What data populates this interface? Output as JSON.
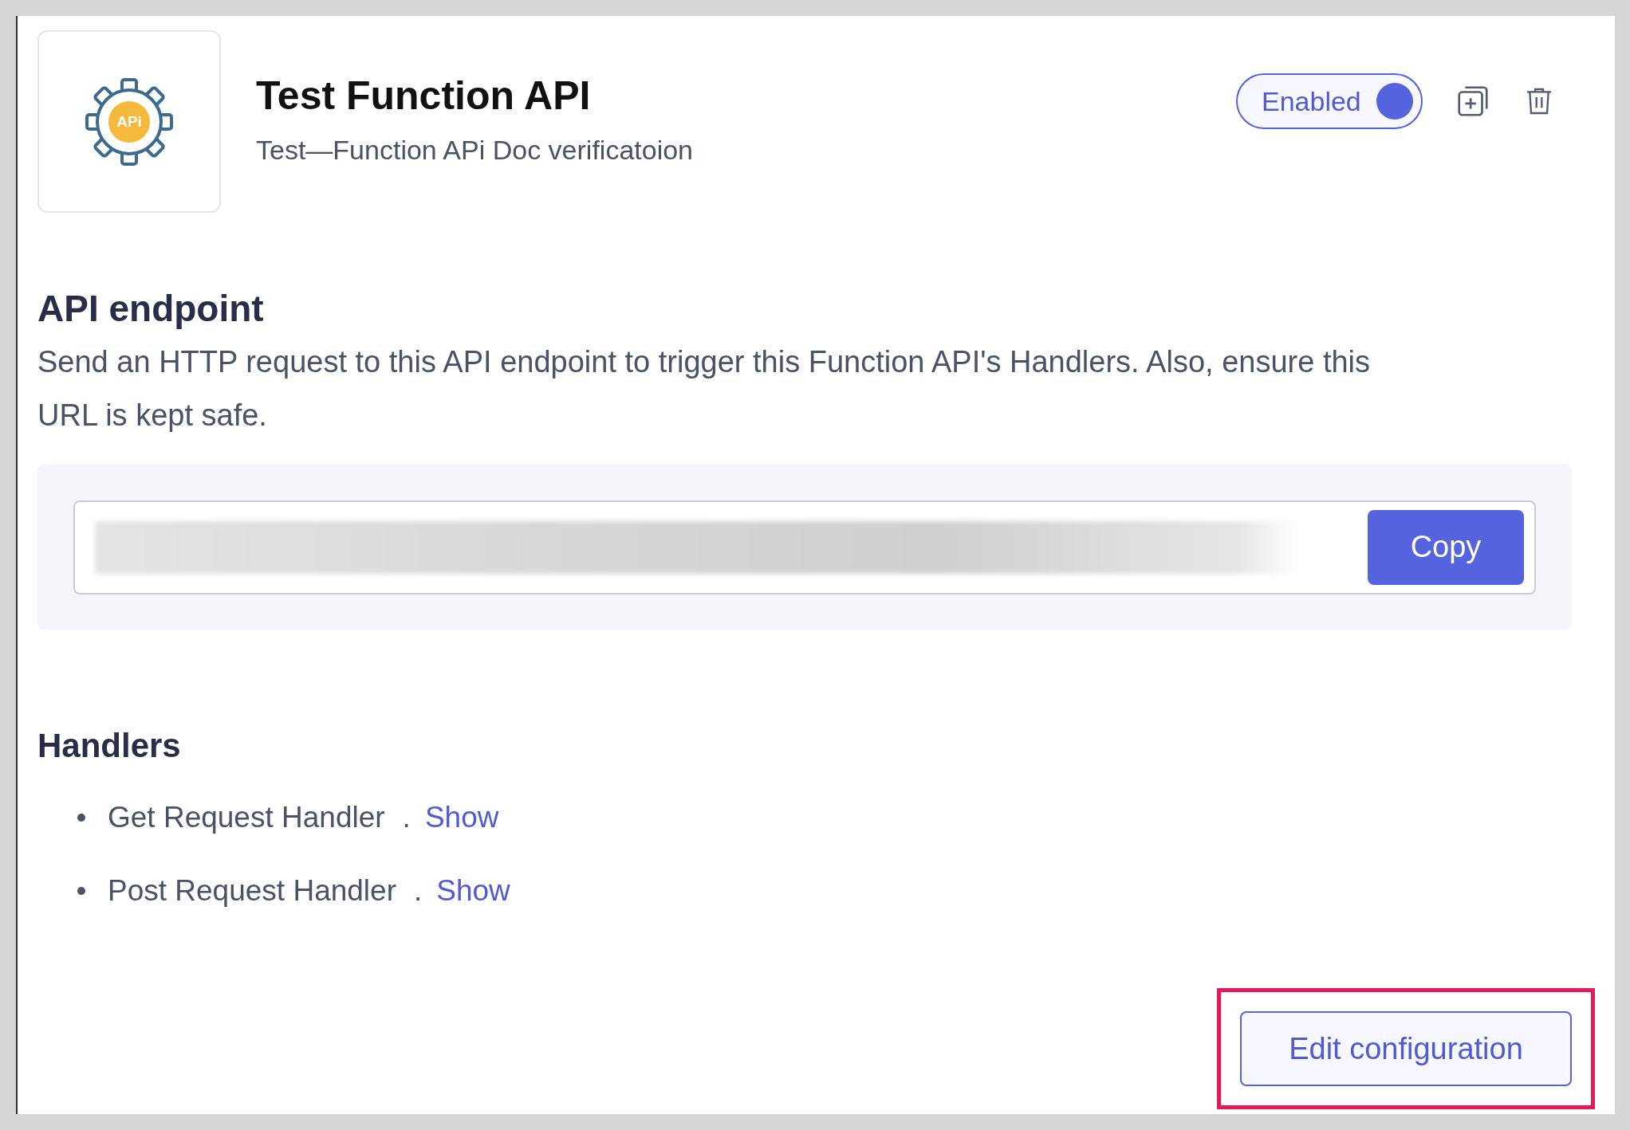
{
  "header": {
    "logo_text": "APi",
    "title": "Test Function API",
    "subtitle": "Test—Function APi Doc verificatoion",
    "toggle": {
      "label": "Enabled",
      "on": true
    }
  },
  "endpoint": {
    "heading": "API endpoint",
    "description": "Send an HTTP request to this API endpoint to trigger this Function API's Handlers. Also, ensure this URL is kept safe.",
    "copy_button": "Copy"
  },
  "handlers": {
    "heading": "Handlers",
    "items": [
      {
        "name": "Get Request Handler",
        "separator": ".",
        "link": "Show"
      },
      {
        "name": "Post Request Handler",
        "separator": ".",
        "link": "Show"
      }
    ]
  },
  "edit_button": {
    "label": "Edit configuration",
    "highlighted": true
  }
}
